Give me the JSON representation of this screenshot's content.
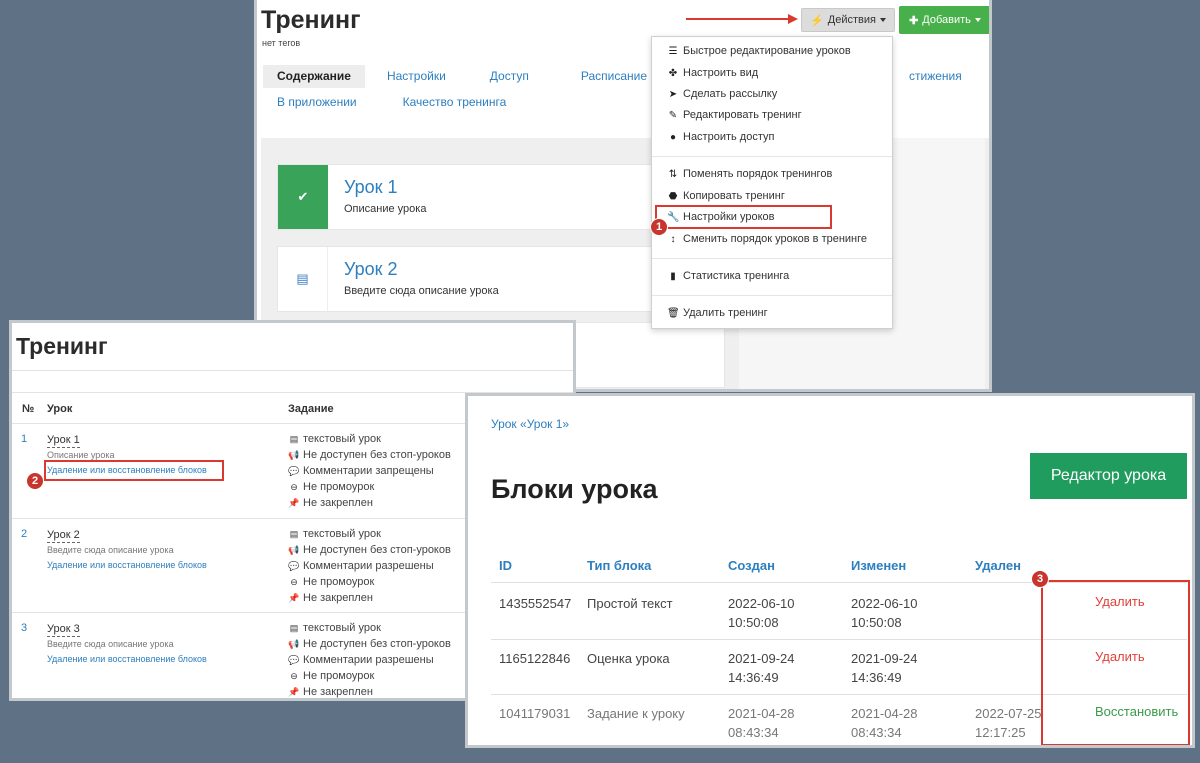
{
  "panel1": {
    "title": "Тренинг",
    "tags": "нет тегов",
    "tabs_row1": [
      "Содержание",
      "Настройки",
      "Доступ",
      "Расписание"
    ],
    "tab_partial": "стижения",
    "tabs_row2": [
      "В приложении",
      "Качество тренинга"
    ],
    "lessons": [
      {
        "title": "Урок 1",
        "desc": "Описание урока",
        "icon": "check-icon"
      },
      {
        "title": "Урок 2",
        "desc": "Введите сюда описание урока",
        "icon": "document-icon"
      }
    ],
    "actions_label": "Действия",
    "add_label": "Добавить",
    "menu": [
      {
        "label": "Быстрое редактирование уроков",
        "icon": "list-icon",
        "glyph": "☰"
      },
      {
        "label": "Настроить вид",
        "icon": "puzzle-icon",
        "glyph": "✤"
      },
      {
        "label": "Сделать рассылку",
        "icon": "send-icon",
        "glyph": "➤"
      },
      {
        "label": "Редактировать тренинг",
        "icon": "edit-icon",
        "glyph": "✎"
      },
      {
        "label": "Настроить доступ",
        "icon": "user-icon",
        "glyph": "●"
      },
      {
        "label": "Поменять порядок тренингов",
        "icon": "sort-icon",
        "glyph": "⇅"
      },
      {
        "label": "Копировать тренинг",
        "icon": "tags-icon",
        "glyph": "⬣"
      },
      {
        "label": "Настройки уроков",
        "icon": "wrench-icon",
        "glyph": "🔧"
      },
      {
        "label": "Сменить порядок уроков в тренинге",
        "icon": "reorder-icon",
        "glyph": "↕"
      },
      {
        "label": "Статистика тренинга",
        "icon": "bar-chart-icon",
        "glyph": "▮"
      },
      {
        "label": "Удалить тренинг",
        "icon": "trash-icon",
        "glyph": "🗑"
      }
    ],
    "marker": "1"
  },
  "panel2": {
    "title": "Тренинг",
    "headers": {
      "num": "№",
      "lesson": "Урок",
      "task": "Задание"
    },
    "rows": [
      {
        "num": "1",
        "name": "Урок 1",
        "desc": "Описание урока",
        "link": "Удаление или восстановление блоков",
        "tasks": [
          "текстовый урок",
          "Не доступен без стоп-уроков",
          "Комментарии запрещены",
          "Не промоурок",
          "Не закреплен"
        ]
      },
      {
        "num": "2",
        "name": "Урок 2",
        "desc": "Введите сюда описание урока",
        "link": "Удаление или восстановление блоков",
        "tasks": [
          "текстовый урок",
          "Не доступен без стоп-уроков",
          "Комментарии разрешены",
          "Не промоурок",
          "Не закреплен"
        ]
      },
      {
        "num": "3",
        "name": "Урок 3",
        "desc": "Введите сюда описание урока",
        "link": "Удаление или восстановление блоков",
        "tasks": [
          "текстовый урок",
          "Не доступен без стоп-уроков",
          "Комментарии разрешены",
          "Не промоурок",
          "Не закреплен"
        ]
      }
    ],
    "task_icons": [
      "▤",
      "📢",
      "💬",
      "⊖",
      "📌"
    ],
    "marker": "2"
  },
  "panel3": {
    "breadcrumb": "Урок «Урок 1»",
    "title": "Блоки урока",
    "editor_button": "Редактор урока",
    "headers": [
      "ID",
      "Тип блока",
      "Создан",
      "Изменен",
      "Удален"
    ],
    "rows": [
      {
        "id": "1435552547",
        "type": "Простой текст",
        "created_date": "2022-06-10",
        "created_time": "10:50:08",
        "modified_date": "2022-06-10",
        "modified_time": "10:50:08",
        "deleted_date": "",
        "deleted_time": "",
        "action": "Удалить",
        "action_color": "#e0413a"
      },
      {
        "id": "1165122846",
        "type": "Оценка урока",
        "created_date": "2021-09-24",
        "created_time": "14:36:49",
        "modified_date": "2021-09-24",
        "modified_time": "14:36:49",
        "deleted_date": "",
        "deleted_time": "",
        "action": "Удалить",
        "action_color": "#e0413a"
      },
      {
        "id": "1041179031",
        "type": "Задание к уроку",
        "created_date": "2021-04-28",
        "created_time": "08:43:34",
        "modified_date": "2021-04-28",
        "modified_time": "08:43:34",
        "deleted_date": "2022-07-25",
        "deleted_time": "12:17:25",
        "action": "Восстановить",
        "action_color": "#3a9a4a"
      }
    ],
    "marker": "3"
  },
  "colors": {
    "accent_blue": "#2d7fbf",
    "green": "#48b04b",
    "highlight_red": "#d9392e",
    "background": "#5f7184"
  }
}
